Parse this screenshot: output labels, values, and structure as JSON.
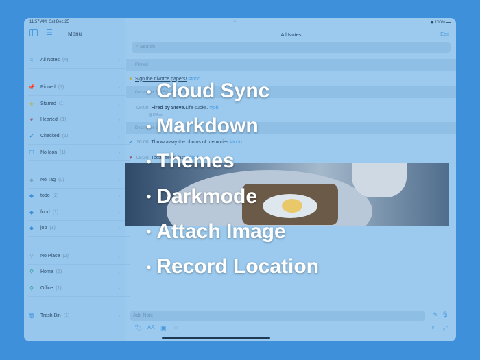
{
  "status": {
    "time": "11:57 AM",
    "date": "Sat Dec 25",
    "battery": "100%"
  },
  "sidebar": {
    "title": "Menu",
    "groups": [
      [
        {
          "label": "All Notes",
          "count": "(4)",
          "icon": "list-icon"
        }
      ],
      [
        {
          "label": "Pinned",
          "count": "(1)",
          "icon": "pin-icon"
        },
        {
          "label": "Starred",
          "count": "(1)",
          "icon": "star-icon"
        },
        {
          "label": "Hearted",
          "count": "(1)",
          "icon": "heart-icon"
        },
        {
          "label": "Checked",
          "count": "(1)",
          "icon": "check-icon"
        },
        {
          "label": "No Icon",
          "count": "(1)",
          "icon": "square-icon"
        }
      ],
      [
        {
          "label": "No Tag",
          "count": "(0)",
          "icon": "tag-icon"
        },
        {
          "label": "todo",
          "count": "(2)",
          "icon": "tag-icon"
        },
        {
          "label": "food",
          "count": "(1)",
          "icon": "tag-icon"
        },
        {
          "label": "job",
          "count": "(1)",
          "icon": "tag-icon"
        }
      ],
      [
        {
          "label": "No Place",
          "count": "(2)",
          "icon": "location-icon"
        },
        {
          "label": "Home",
          "count": "(1)",
          "icon": "location-icon"
        },
        {
          "label": "Office",
          "count": "(1)",
          "icon": "location-icon"
        }
      ],
      [
        {
          "label": "Trash Bin",
          "count": "(1)",
          "icon": "trash-icon"
        }
      ]
    ]
  },
  "main": {
    "title": "All Notes",
    "edit": "Edit",
    "search_placeholder": "Search",
    "sections": [
      "Pinned",
      "December 24 (Fri), Yesterday",
      "December 15"
    ],
    "notes": [
      {
        "time": "",
        "text": "Sign the divorce papers!",
        "tag": "#todo"
      },
      {
        "time": "09:00",
        "bold": "Fired by Steve.",
        "text": " Life sucks.",
        "tag": "#job",
        "place": "@Office"
      },
      {
        "time": "16:00",
        "text": "Throw away the photos of memories",
        "tag": "#todo"
      },
      {
        "time": "08:30",
        "text": "Today breakfast",
        "tag": "#food"
      }
    ],
    "add_placeholder": "Add Note",
    "char_count": "0"
  },
  "features": [
    "Cloud Sync",
    "Markdown",
    "Themes",
    "Darkmode",
    "Attach Image",
    "Record Location"
  ]
}
